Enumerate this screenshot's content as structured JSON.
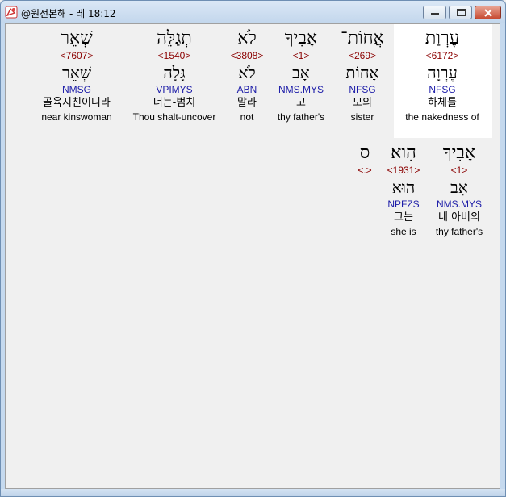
{
  "window": {
    "title": "@원전본해 - 레 18:12"
  },
  "row1": [
    {
      "word": "עֶרְוַת",
      "num": "<6172>",
      "lemma": "עֶרְוָה",
      "morph": "NFSG",
      "kor": "하체를",
      "eng": "the nakedness of",
      "highlighted": true
    },
    {
      "word": "אֲחוֹת־",
      "num": "<269>",
      "lemma": "אָחוֹת",
      "morph": "NFSG",
      "kor": "모의",
      "eng": "sister",
      "highlighted": false
    },
    {
      "word": "אָבִיךָ",
      "num": "<1>",
      "lemma": "אָב",
      "morph": "NMS.MYS",
      "kor": "고",
      "eng": "thy father's",
      "highlighted": false
    },
    {
      "word": "לֹא",
      "num": "<3808>",
      "lemma": "לֹא",
      "morph": "ABN",
      "kor": "말라",
      "eng": "not",
      "highlighted": false
    },
    {
      "word": "תְגַלֵּה",
      "num": "<1540>",
      "lemma": "גָּלָה",
      "morph": "VPIMYS",
      "kor": "너는-범치",
      "eng": "Thou shalt-uncover",
      "highlighted": false
    },
    {
      "word": "שְׁאֵר",
      "num": "<7607>",
      "lemma": "שְׁאֵר",
      "morph": "NMSG",
      "kor": "골육지친이니라",
      "eng": "near kinswoman",
      "highlighted": false
    }
  ],
  "row2": [
    {
      "word": "אָבִיךָ",
      "num": "<1>",
      "lemma": "אָב",
      "morph": "NMS.MYS",
      "kor": "네 아비의",
      "eng": "thy father's"
    },
    {
      "word": "הִוא׃",
      "num": "<1931>",
      "lemma": "הוּא",
      "morph": "NPFZS",
      "kor": "그는",
      "eng": "she is"
    },
    {
      "word": "ס",
      "num": "<.>",
      "lemma": "",
      "morph": "",
      "kor": "",
      "eng": ""
    }
  ]
}
